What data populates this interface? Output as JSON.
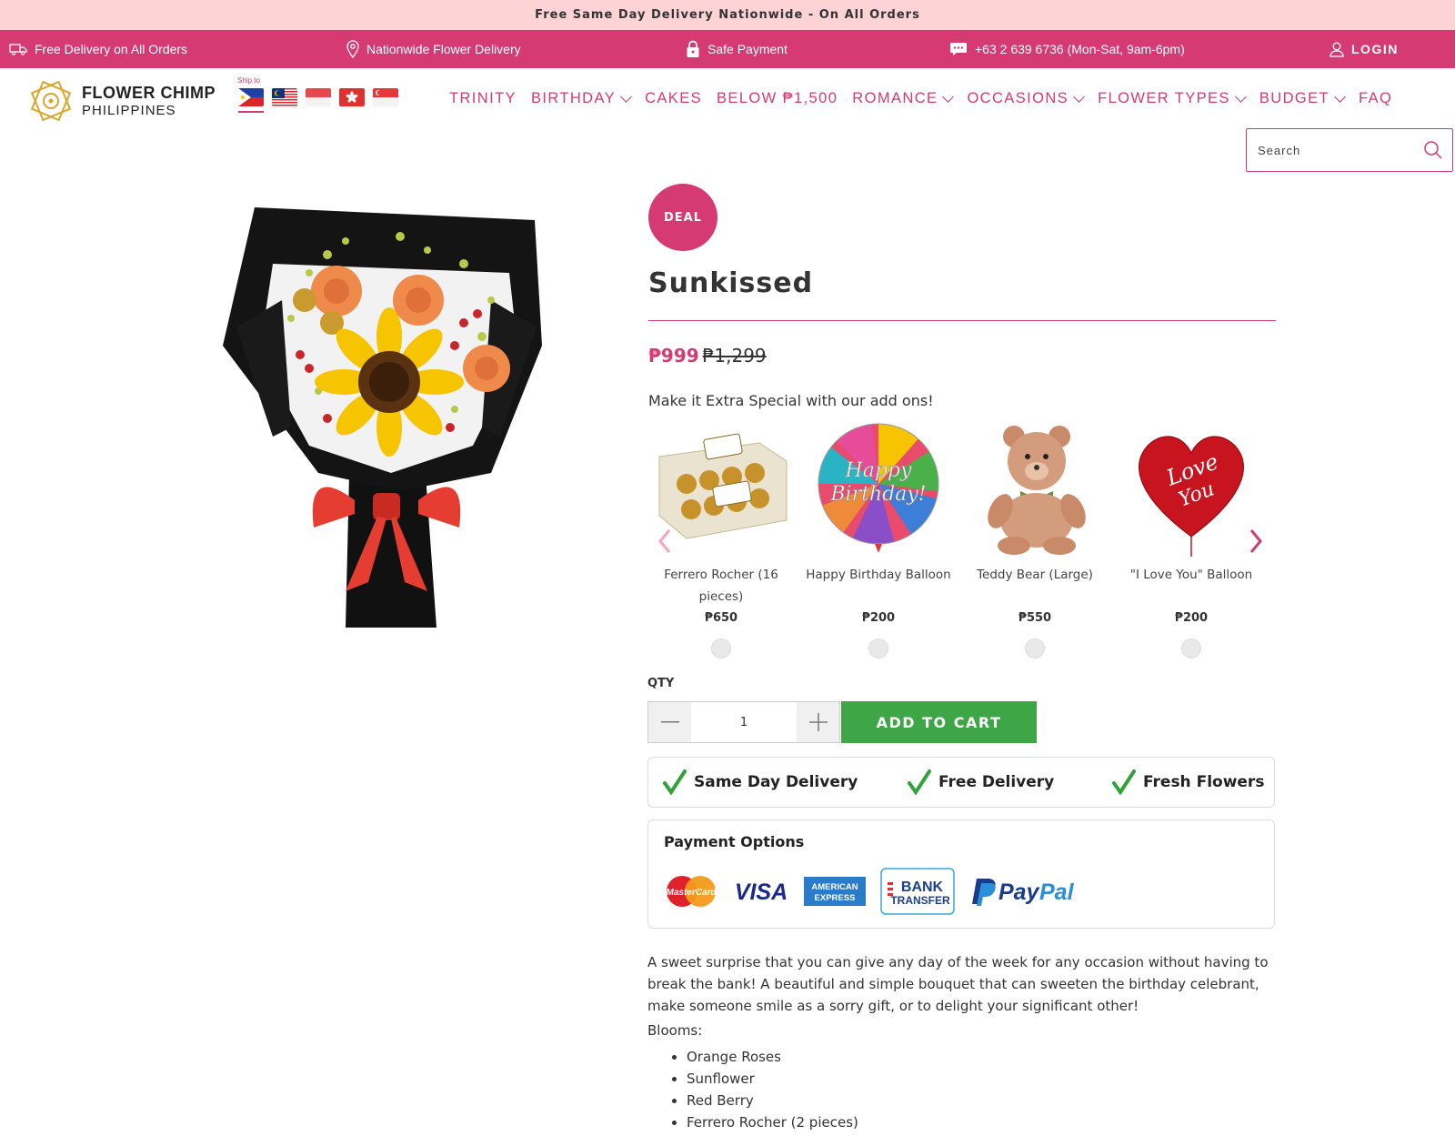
{
  "promo": {
    "text": "Free Same Day Delivery Nationwide - On All Orders"
  },
  "info_bar": {
    "free_delivery": "Free Delivery on All Orders",
    "nationwide": "Nationwide Flower Delivery",
    "safe_payment": "Safe Payment",
    "phone": "+63 2 639 6736 (Mon-Sat, 9am-6pm)",
    "login": "LOGIN"
  },
  "logo": {
    "line1": "FLOWER CHIMP",
    "line2": "PHILIPPINES"
  },
  "ship_to": {
    "label": "Ship to",
    "flags": [
      "philippines-flag",
      "malaysia-flag",
      "indonesia-flag",
      "hong-kong-flag",
      "singapore-flag"
    ],
    "selected": "philippines-flag"
  },
  "nav": {
    "items": [
      {
        "label": "TRINITY",
        "dropdown": false
      },
      {
        "label": "BIRTHDAY",
        "dropdown": true
      },
      {
        "label": "CAKES",
        "dropdown": false
      },
      {
        "label": "BELOW ₱1,500",
        "dropdown": false
      },
      {
        "label": "ROMANCE",
        "dropdown": true
      },
      {
        "label": "OCCASIONS",
        "dropdown": true
      },
      {
        "label": "FLOWER TYPES",
        "dropdown": true
      },
      {
        "label": "BUDGET",
        "dropdown": true
      },
      {
        "label": "FAQ",
        "dropdown": false
      }
    ]
  },
  "search": {
    "placeholder": "Search",
    "value": ""
  },
  "product": {
    "badge": "DEAL",
    "title": "Sunkissed",
    "price_sale": "₱999",
    "price_original": "₱1,299",
    "addons_heading": "Make it Extra Special with our add ons!",
    "addons": [
      {
        "name": "Ferrero Rocher (16 pieces)",
        "price": "₱650",
        "icon": "chocolate-box"
      },
      {
        "name": "Happy Birthday Balloon",
        "price": "₱200",
        "icon": "birthday-balloon"
      },
      {
        "name": "Teddy Bear (Large)",
        "price": "₱550",
        "icon": "teddy-bear"
      },
      {
        "name": "\"I Love You\" Balloon",
        "price": "₱200",
        "icon": "heart-balloon"
      }
    ],
    "qty_label": "QTY",
    "qty_value": "1",
    "add_to_cart": "ADD TO CART",
    "benefits": [
      "Same Day Delivery",
      "Free Delivery",
      "Fresh Flowers"
    ],
    "payment_title": "Payment Options",
    "payment_methods": [
      "MasterCard",
      "VISA",
      "AMERICAN EXPRESS",
      "BANK TRANSFER",
      "PayPal"
    ],
    "description": "A sweet surprise that you can give any day of the week for any occasion without having to break the bank! A beautiful and simple bouquet that can sweeten the birthday celebrant, make someone smile as a sorry gift, or to delight your significant other!",
    "blooms_label": "Blooms:",
    "blooms": [
      "Orange Roses",
      "Sunflower",
      "Red Berry",
      "Ferrero Rocher (2 pieces)"
    ]
  },
  "colors": {
    "brand": "#d63a73",
    "promo_bg": "#fdd3d6",
    "cart_green": "#3ea646",
    "check_green": "#2fa33a"
  }
}
